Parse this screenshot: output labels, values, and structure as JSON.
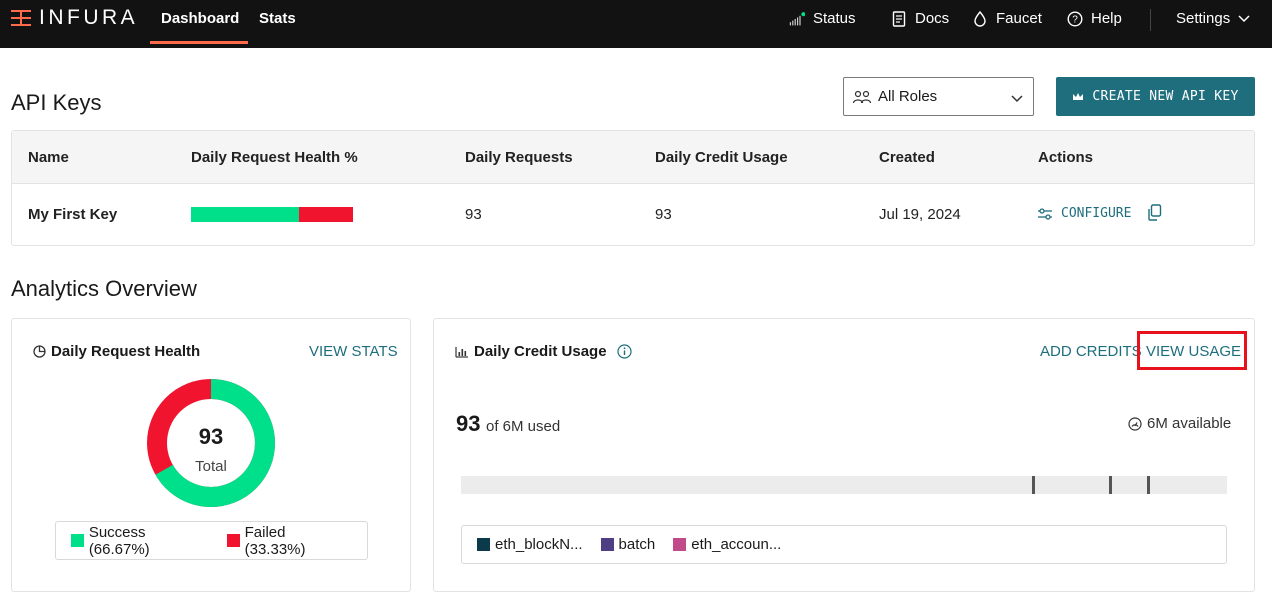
{
  "nav": {
    "logo_text": "INFURA",
    "tabs": [
      {
        "label": "Dashboard",
        "active": true
      },
      {
        "label": "Stats",
        "active": false
      }
    ],
    "links": [
      {
        "label": "Status",
        "icon": "signal-bars-icon"
      },
      {
        "label": "Docs",
        "icon": "document-icon"
      },
      {
        "label": "Faucet",
        "icon": "droplet-icon"
      },
      {
        "label": "Help",
        "icon": "question-circle-icon"
      }
    ],
    "settings_label": "Settings"
  },
  "api_keys": {
    "title": "API Keys",
    "roles_select": {
      "value": "All Roles",
      "icon": "users-icon"
    },
    "create_button": "CREATE NEW API KEY",
    "columns": [
      "Name",
      "Daily Request Health %",
      "Daily Requests",
      "Daily Credit Usage",
      "Created",
      "Actions"
    ],
    "rows": [
      {
        "name": "My First Key",
        "health_success": 0.6667,
        "requests": "93",
        "credit_usage": "93",
        "created": "Jul 19, 2024",
        "action": "CONFIGURE"
      }
    ]
  },
  "analytics": {
    "title": "Analytics Overview",
    "health_card": {
      "title": "Daily Request Health",
      "link": "VIEW STATS",
      "total": "93",
      "total_label": "Total",
      "success_fraction": 0.6667,
      "legend": [
        {
          "label": "Success (66.67%)",
          "color": "#00e08a"
        },
        {
          "label": "Failed (33.33%)",
          "color": "#f0142f"
        }
      ]
    },
    "credit_card": {
      "title": "Daily Credit Usage",
      "add_credits": "ADD CREDITS",
      "view_usage": "VIEW USAGE",
      "used": "93",
      "used_suffix": "of 6M used",
      "available": "6M available",
      "legend": [
        {
          "label": "eth_blockN...",
          "color": "#0b3a4a"
        },
        {
          "label": "batch",
          "color": "#4e3f84"
        },
        {
          "label": "eth_accoun...",
          "color": "#c04a8a"
        }
      ]
    }
  },
  "colors": {
    "accent": "#1e6e7d",
    "brand": "#ff6b4a",
    "success": "#00e08a",
    "failed": "#f0142f",
    "highlight": "#e8121c"
  }
}
